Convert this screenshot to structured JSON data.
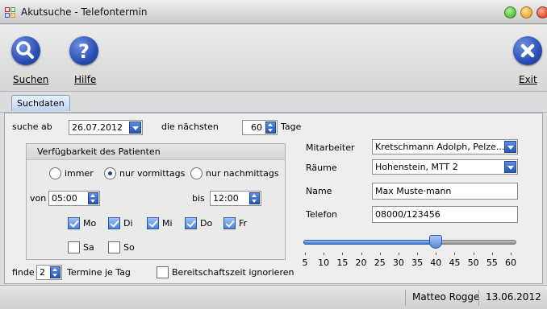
{
  "window": {
    "title": "Akutsuche - Telefontermin",
    "controls": {
      "minimize": {
        "icon": "minimize-icon",
        "color": "#4fbf3a"
      },
      "maximize": {
        "icon": "maximize-icon",
        "color": "#f0a830"
      },
      "close": {
        "icon": "close-icon",
        "color": "#e04a2a"
      }
    }
  },
  "toolbar": {
    "search": {
      "label": "Suchen",
      "icon": "search-icon"
    },
    "help": {
      "label": "Hilfe",
      "icon": "help-icon"
    },
    "exit": {
      "label": "Exit",
      "icon": "exit-icon"
    }
  },
  "tabs": [
    {
      "label": "Suchdaten",
      "selected": true
    }
  ],
  "search": {
    "from_label": "suche ab",
    "from_date": "26.07.2012",
    "next_label": "die nächsten",
    "days_value": "60",
    "days_label": "Tage"
  },
  "availability": {
    "title": "Verfügbarkeit des Patienten",
    "options": [
      {
        "label": "immer",
        "selected": false
      },
      {
        "label": "nur vormittags",
        "selected": true
      },
      {
        "label": "nur nachmittags",
        "selected": false
      }
    ],
    "from_label": "von",
    "from_time": "05:00",
    "to_label": "bis",
    "to_time": "12:00",
    "days": [
      {
        "label": "Mo",
        "checked": true
      },
      {
        "label": "Di",
        "checked": true
      },
      {
        "label": "Mi",
        "checked": true
      },
      {
        "label": "Do",
        "checked": true
      },
      {
        "label": "Fr",
        "checked": true
      },
      {
        "label": "Sa",
        "checked": false
      },
      {
        "label": "So",
        "checked": false
      }
    ]
  },
  "find": {
    "label": "finde",
    "count": "2",
    "per_day_label": "Termine je Tag",
    "ignore_label": "Bereitschaftszeit ignorieren",
    "ignore_checked": false
  },
  "details": {
    "staff_label": "Mitarbeiter",
    "staff_value": "Kretschmann Adolph, Pelze...",
    "rooms_label": "Räume",
    "rooms_value": "Hohenstein, MTT 2",
    "name_label": "Name",
    "name_value": "Max Muste·mann",
    "phone_label": "Telefon",
    "phone_value": "08000/123456"
  },
  "slider": {
    "value": 40,
    "min": 5,
    "max": 60,
    "tick_labels": [
      "5",
      "10",
      "15",
      "20",
      "25",
      "30",
      "35",
      "40",
      "45",
      "50",
      "55",
      "60"
    ]
  },
  "status": {
    "user": "Matteo Rogge",
    "date": "13.06.2012"
  },
  "colors": {
    "accent": "#2f5fc4",
    "tab_border": "#7e9fcb"
  }
}
